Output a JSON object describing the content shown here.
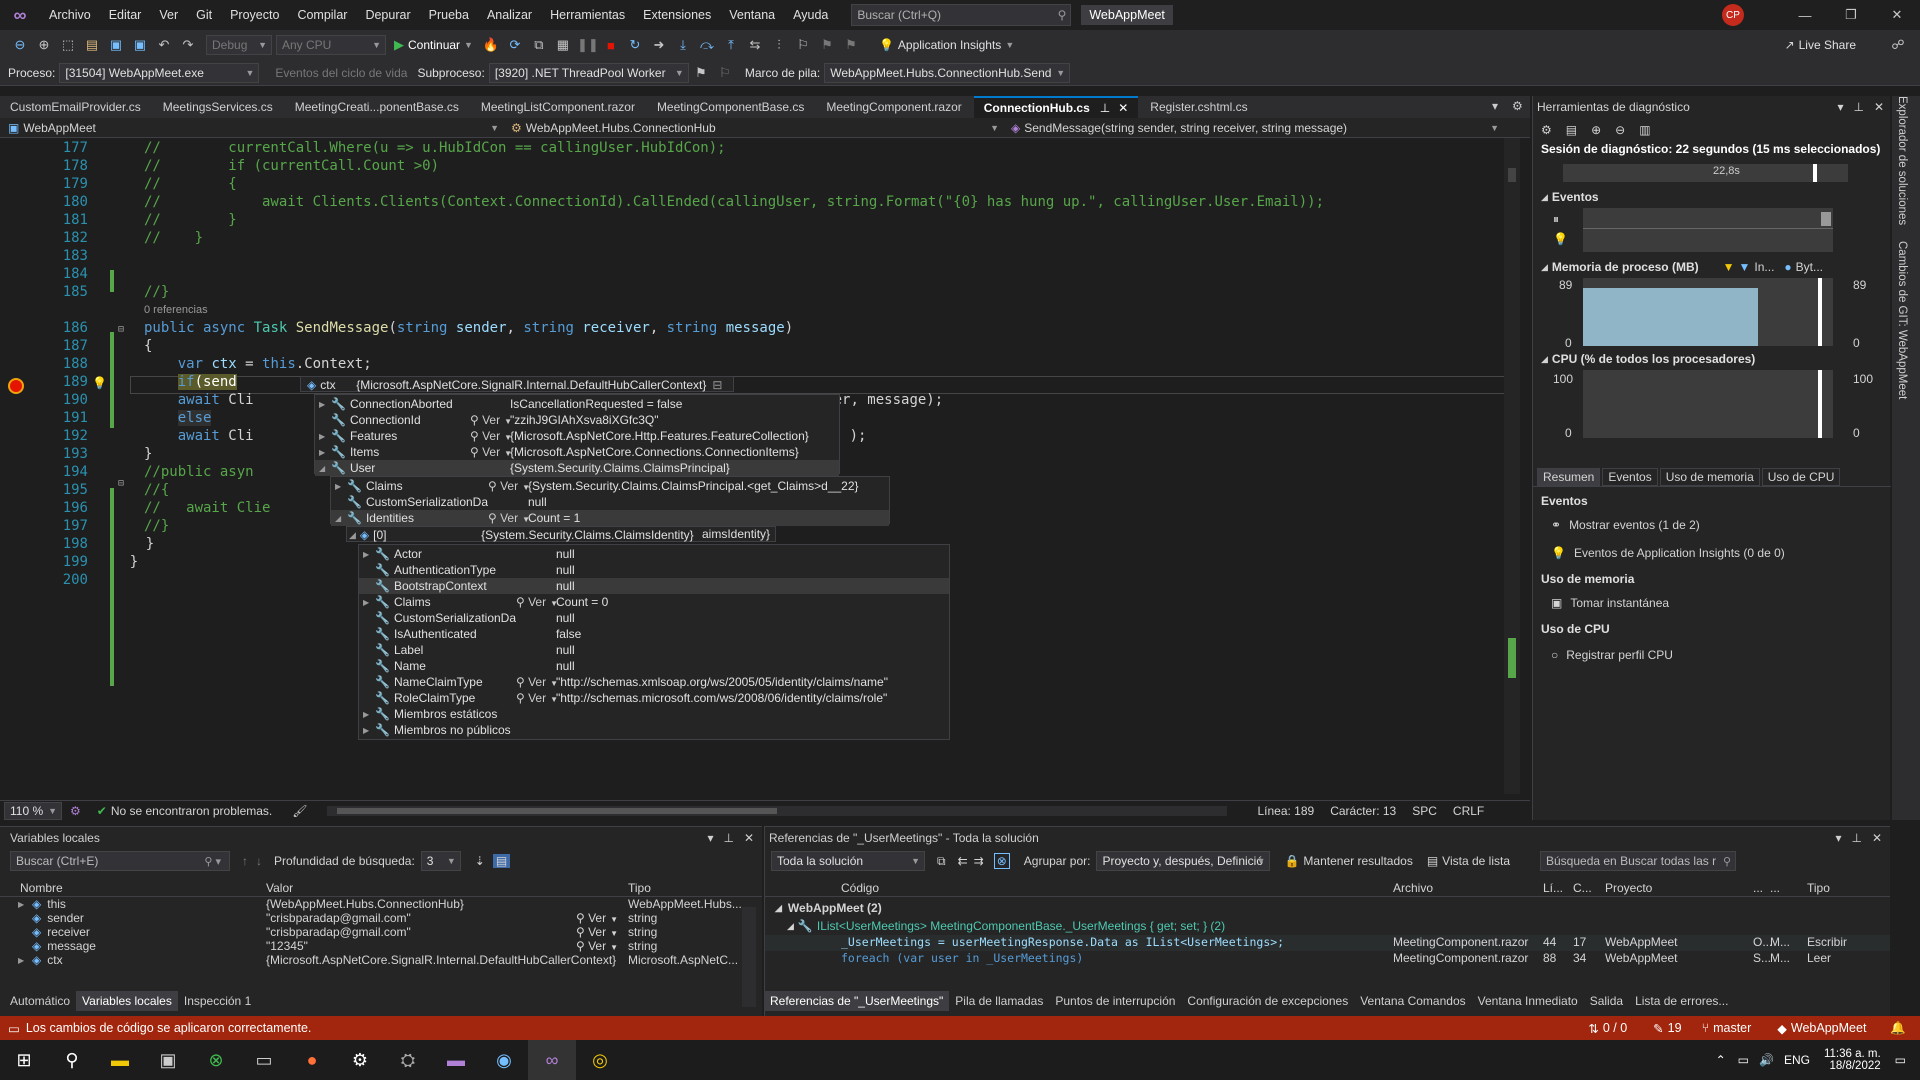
{
  "titlebar": {
    "menus": [
      "Archivo",
      "Editar",
      "Ver",
      "Git",
      "Proyecto",
      "Compilar",
      "Depurar",
      "Prueba",
      "Analizar",
      "Herramientas",
      "Extensiones",
      "Ventana",
      "Ayuda"
    ],
    "search_placeholder": "Buscar (Ctrl+Q)",
    "solution_name": "WebAppMeet",
    "user_initials": "CP"
  },
  "toolbar": {
    "config": "Debug",
    "platform": "Any CPU",
    "continue_label": "Continuar",
    "app_insights": "Application Insights",
    "live_share": "Live Share"
  },
  "procbar": {
    "process_label": "Proceso:",
    "process_value": "[31504] WebAppMeet.exe",
    "lifecycle_label": "Eventos del ciclo de vida",
    "thread_label": "Subproceso:",
    "thread_value": "[3920] .NET ThreadPool Worker",
    "stack_label": "Marco de pila:",
    "stack_value": "WebAppMeet.Hubs.ConnectionHub.Send"
  },
  "tabs": [
    {
      "label": "CustomEmailProvider.cs"
    },
    {
      "label": "MeetingsServices.cs"
    },
    {
      "label": "MeetingCreati...ponentBase.cs"
    },
    {
      "label": "MeetingListComponent.razor"
    },
    {
      "label": "MeetingComponentBase.cs"
    },
    {
      "label": "MeetingComponent.razor"
    },
    {
      "label": "ConnectionHub.cs"
    },
    {
      "label": "Register.cshtml.cs"
    }
  ],
  "navbar": {
    "project": "WebAppMeet",
    "type": "WebAppMeet.Hubs.ConnectionHub",
    "member": "SendMessage(string sender, string receiver, string message)"
  },
  "editor": {
    "line_numbers": [
      "177",
      "178",
      "179",
      "180",
      "181",
      "182",
      "183",
      "184",
      "185",
      "186",
      "187",
      "188",
      "189",
      "190",
      "191",
      "192",
      "193",
      "194",
      "195",
      "196",
      "197",
      "198",
      "199",
      "200"
    ],
    "references_hint": "0 referencias",
    "zoom": "110 %",
    "problems": "No se encontraron problemas.",
    "line": "Línea: 189",
    "char": "Carácter: 13",
    "spc": "SPC",
    "crlf": "CRLF"
  },
  "datatip": {
    "root": {
      "name": "ctx",
      "value": "{Microsoft.AspNetCore.SignalR.Internal.DefaultHubCallerContext}"
    },
    "level1": [
      {
        "name": "ConnectionAborted",
        "value": "IsCancellationRequested = false",
        "ver": ""
      },
      {
        "name": "ConnectionId",
        "value": "\"zzihJ9GIAhXsva8iXGfc3Q\"",
        "ver": "Ver"
      },
      {
        "name": "Features",
        "value": "{Microsoft.AspNetCore.Http.Features.FeatureCollection}",
        "ver": "Ver"
      },
      {
        "name": "Items",
        "value": "{Microsoft.AspNetCore.Connections.ConnectionItems}",
        "ver": "Ver"
      },
      {
        "name": "User",
        "value": "{System.Security.Claims.ClaimsPrincipal}",
        "ver": ""
      }
    ],
    "level2": [
      {
        "name": "Claims",
        "value": "{System.Security.Claims.ClaimsPrincipal.<get_Claims>d__22}",
        "ver": "Ver"
      },
      {
        "name": "CustomSerializationData",
        "value": "null",
        "ver": ""
      },
      {
        "name": "Identities",
        "value": "Count = 1",
        "ver": "Ver"
      }
    ],
    "level3": {
      "name": "[0]",
      "value": "{System.Security.Claims.ClaimsIdentity}",
      "overflow": "aimsIdentity}"
    },
    "level4": [
      {
        "name": "Actor",
        "value": "null",
        "ver": ""
      },
      {
        "name": "AuthenticationType",
        "value": "null",
        "ver": ""
      },
      {
        "name": "BootstrapContext",
        "value": "null",
        "ver": ""
      },
      {
        "name": "Claims",
        "value": "Count = 0",
        "ver": "Ver"
      },
      {
        "name": "CustomSerializationData",
        "value": "null",
        "ver": ""
      },
      {
        "name": "IsAuthenticated",
        "value": "false",
        "ver": ""
      },
      {
        "name": "Label",
        "value": "null",
        "ver": ""
      },
      {
        "name": "Name",
        "value": "null",
        "ver": ""
      },
      {
        "name": "NameClaimType",
        "value": "\"http://schemas.xmlsoap.org/ws/2005/05/identity/claims/name\"",
        "ver": "Ver"
      },
      {
        "name": "RoleClaimType",
        "value": "\"http://schemas.microsoft.com/ws/2008/06/identity/claims/role\"",
        "ver": "Ver"
      },
      {
        "name": "Miembros estáticos",
        "value": "",
        "ver": ""
      },
      {
        "name": "Miembros no públicos",
        "value": "",
        "ver": ""
      }
    ]
  },
  "diag": {
    "title": "Herramientas de diagnóstico",
    "session": "Sesión de diagnóstico: 22 segundos (15 ms seleccionados)",
    "time_marker": "22,8s",
    "events": "Eventos",
    "memory": "Memoria de proceso (MB)",
    "mem_legend1": "In...",
    "mem_legend2": "Byt...",
    "mem_max": "89",
    "mem_min": "0",
    "cpu": "CPU (% de todos los procesadores)",
    "cpu_max": "100",
    "cpu_min": "0",
    "tabs": [
      "Resumen",
      "Eventos",
      "Uso de memoria",
      "Uso de CPU"
    ],
    "sec_events": "Eventos",
    "show_events": "Mostrar eventos (1 de 2)",
    "ai_events": "Eventos de Application Insights (0 de 0)",
    "sec_mem": "Uso de memoria",
    "snapshot": "Tomar instantánea",
    "sec_cpu": "Uso de CPU",
    "record_cpu": "Registrar perfil CPU"
  },
  "side_strip": [
    "Explorador de soluciones",
    "Cambios de GIT: WebAppMeet"
  ],
  "locals": {
    "title": "Variables locales",
    "search_placeholder": "Buscar (Ctrl+E)",
    "depth_label": "Profundidad de búsqueda:",
    "depth_value": "3",
    "columns": [
      "Nombre",
      "Valor",
      "Tipo"
    ],
    "rows": [
      {
        "name": "this",
        "value": "{WebAppMeet.Hubs.ConnectionHub}",
        "ver": "",
        "type": "WebAppMeet.Hubs..."
      },
      {
        "name": "sender",
        "value": "\"crisbparadap@gmail.com\"",
        "ver": "Ver",
        "type": "string"
      },
      {
        "name": "receiver",
        "value": "\"crisbparadap@gmail.com\"",
        "ver": "Ver",
        "type": "string"
      },
      {
        "name": "message",
        "value": "\"12345\"",
        "ver": "Ver",
        "type": "string"
      },
      {
        "name": "ctx",
        "value": "{Microsoft.AspNetCore.SignalR.Internal.DefaultHubCallerContext}",
        "ver": "",
        "type": "Microsoft.AspNetC..."
      }
    ],
    "tabs": [
      "Automático",
      "Variables locales",
      "Inspección 1"
    ]
  },
  "refs": {
    "title": "Referencias de \"_UserMeetings\" - Toda la solución",
    "scope": "Toda la solución",
    "group_label": "Agrupar por:",
    "group_value": "Proyecto y, después, Definició",
    "keep_results": "Mantener resultados",
    "list_view": "Vista de lista",
    "search_placeholder": "Búsqueda en Buscar todas las r",
    "columns": [
      "Código",
      "Archivo",
      "Lí...",
      "C...",
      "Proyecto",
      "...",
      "...",
      "Tipo"
    ],
    "group": "WebAppMeet (2)",
    "definition": "IList<UserMeetings> MeetingComponentBase._UserMeetings { get; set; } (2)",
    "rows": [
      {
        "code": "_UserMeetings = userMeetingResponse.Data as IList<UserMeetings>;",
        "file": "MeetingComponent.razor",
        "line": "44",
        "col": "17",
        "project": "WebAppMeet",
        "c1": "O...",
        "c2": "M...",
        "kind": "Escribir"
      },
      {
        "code": "foreach (var user in _UserMeetings)",
        "file": "MeetingComponent.razor",
        "line": "88",
        "col": "34",
        "project": "WebAppMeet",
        "c1": "S...",
        "c2": "M...",
        "kind": "Leer"
      }
    ],
    "tabs": [
      "Referencias de \"_UserMeetings\"",
      "Pila de llamadas",
      "Puntos de interrupción",
      "Configuración de excepciones",
      "Ventana Comandos",
      "Ventana Inmediato",
      "Salida",
      "Lista de errores..."
    ]
  },
  "statusbar": {
    "message": "Los cambios de código se aplicaron correctamente.",
    "arrows": "0 / 0",
    "edits": "19",
    "branch": "master",
    "repo": "WebAppMeet"
  },
  "taskbar": {
    "lang": "ENG",
    "time": "11:36 a. m.",
    "date": "18/8/2022"
  },
  "colors": {
    "accent": "#007acc",
    "status": "#a1260d",
    "breakpoint": "#e51400"
  }
}
